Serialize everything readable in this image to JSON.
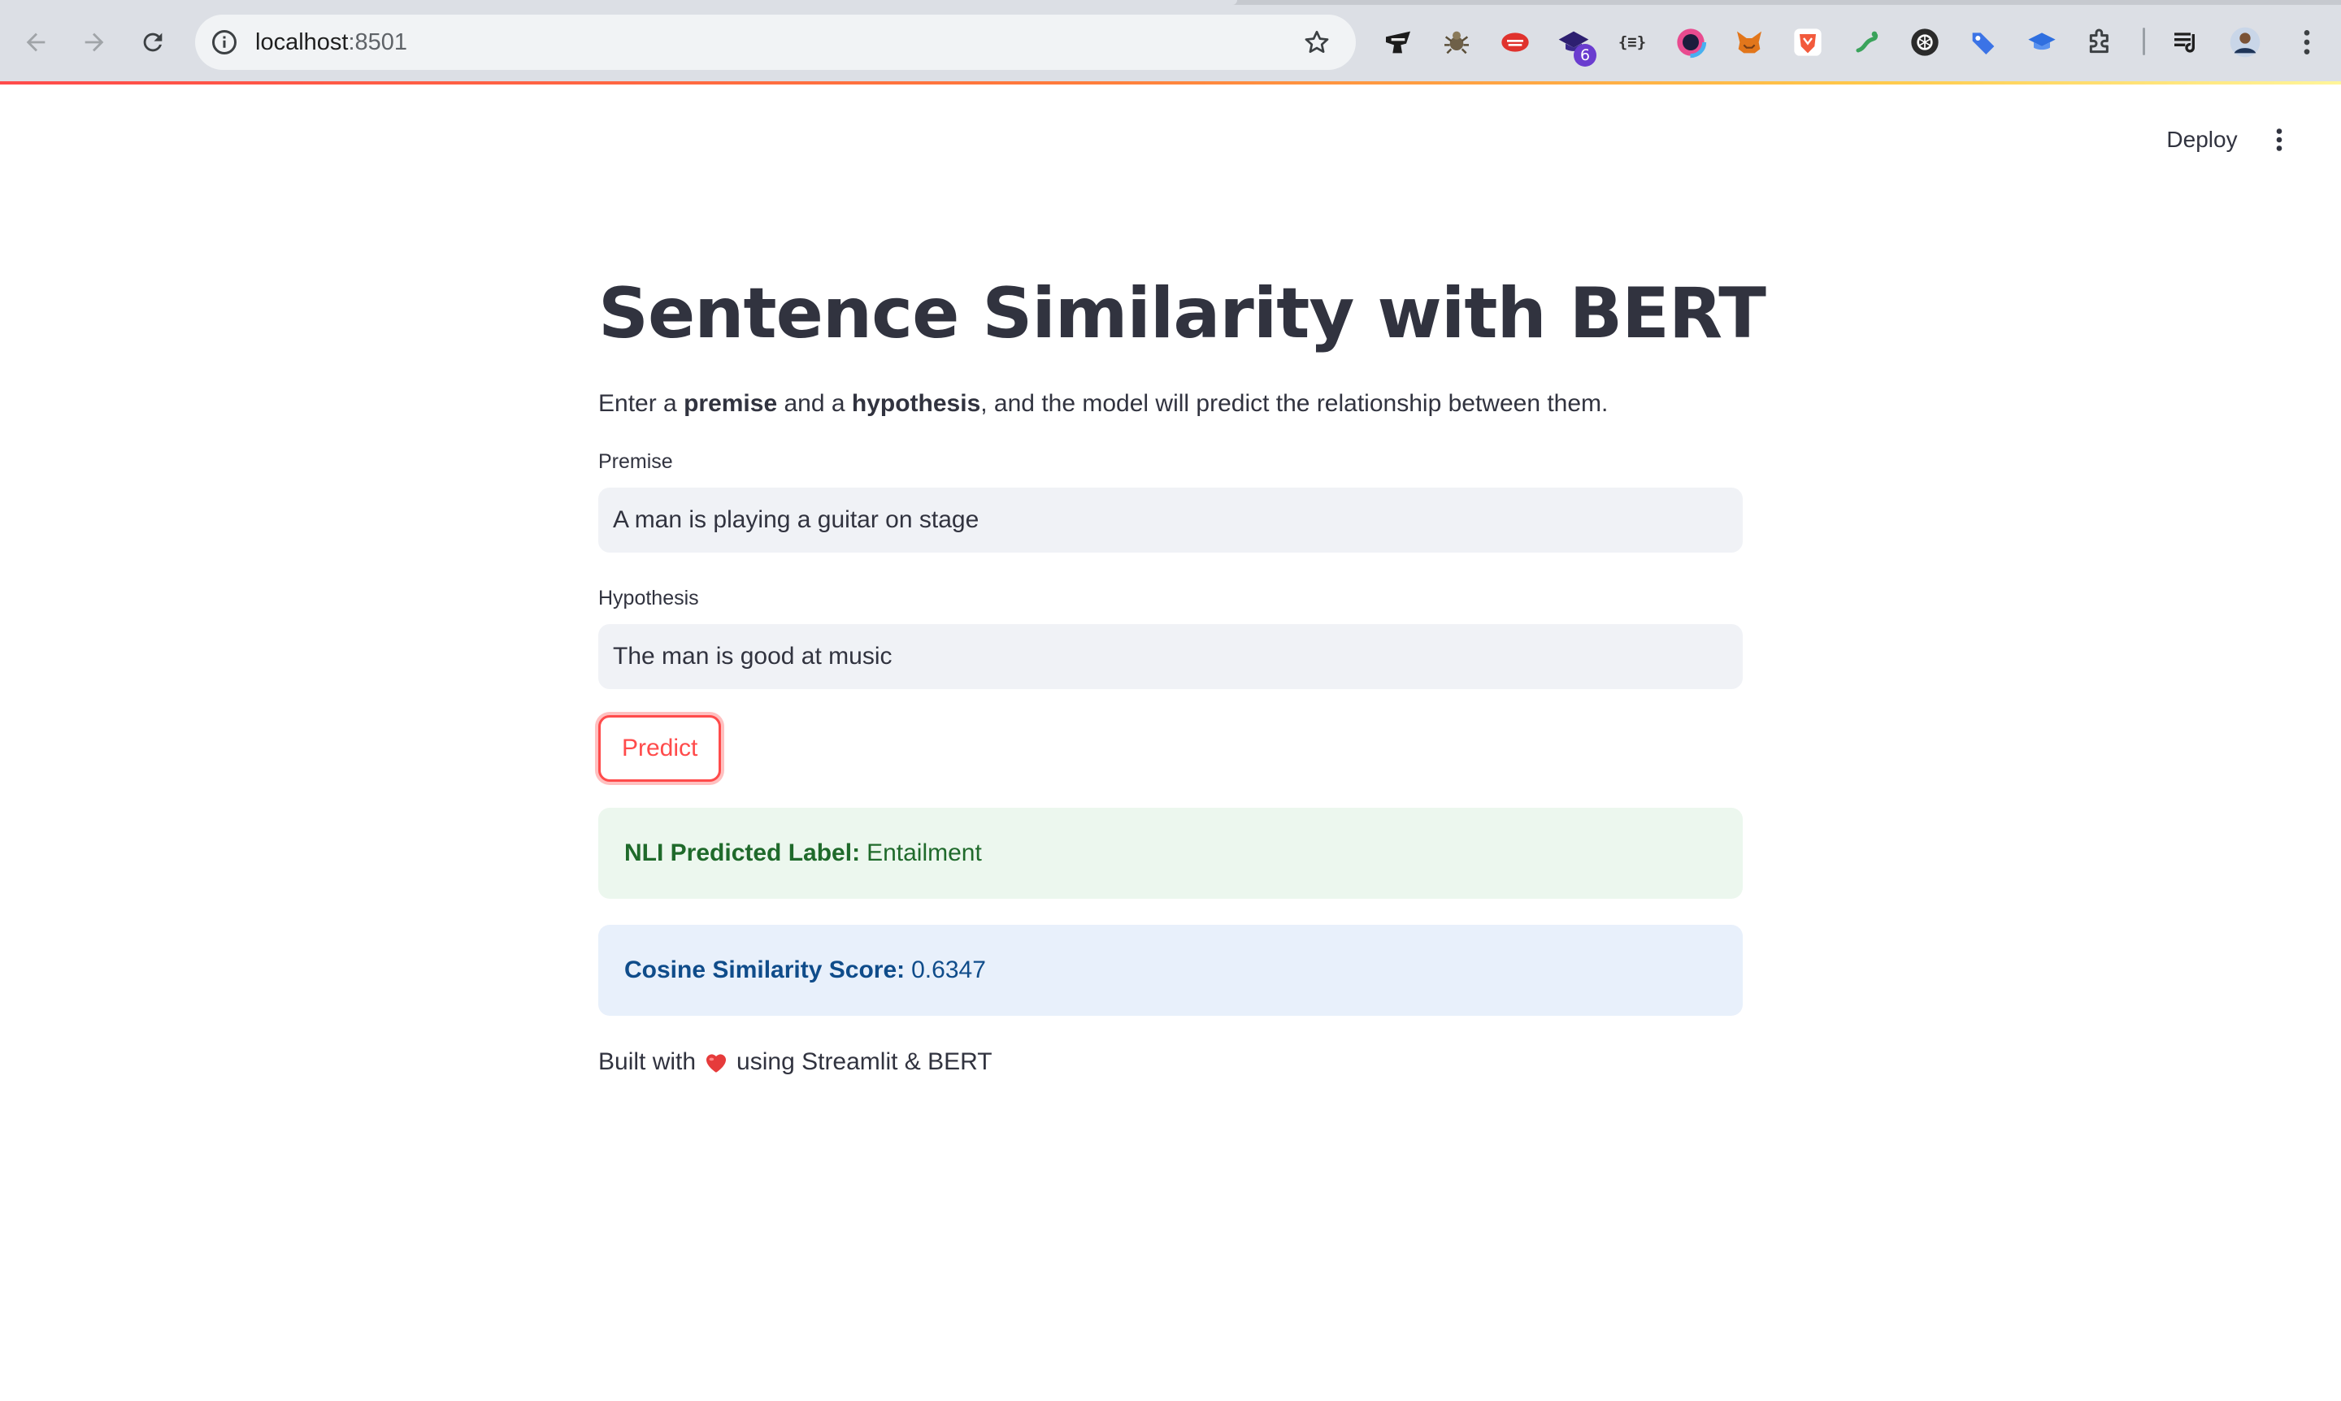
{
  "browser": {
    "url_host": "localhost",
    "url_port": ":8501",
    "extensions": [
      {
        "icon": "ninja-extension-icon"
      },
      {
        "icon": "spider-extension-icon"
      },
      {
        "icon": "red-cloud-extension-icon"
      },
      {
        "icon": "graduation-cap-extension-icon",
        "badge": "6"
      },
      {
        "icon": "json-formatter-extension-icon",
        "glyph": "{≡}"
      },
      {
        "icon": "color-picker-extension-icon"
      },
      {
        "icon": "metamask-fox-extension-icon"
      },
      {
        "icon": "brave-lion-extension-icon"
      },
      {
        "icon": "lizard-extension-icon"
      },
      {
        "icon": "openai-extension-icon"
      },
      {
        "icon": "blue-tag-extension-icon"
      },
      {
        "icon": "blue-cap-extension-icon"
      },
      {
        "icon": "puzzle-extensions-icon"
      }
    ],
    "colors": {
      "chrome_bg": "#dcdfe5",
      "omnibox_bg": "#f1f3f5"
    }
  },
  "app": {
    "header": {
      "deploy_label": "Deploy"
    },
    "title": "Sentence Similarity with BERT",
    "intro": {
      "part1": "Enter a ",
      "bold1": "premise",
      "part2": " and a ",
      "bold2": "hypothesis",
      "part3": ", and the model will predict the relationship between them."
    },
    "premise": {
      "label": "Premise",
      "value": "A man is playing a guitar on stage"
    },
    "hypothesis": {
      "label": "Hypothesis",
      "value": "The man is good at music"
    },
    "predict_label": "Predict",
    "results": {
      "nli_label": "NLI Predicted Label:",
      "nli_value": "Entailment",
      "cosine_label": "Cosine Similarity Score:",
      "cosine_value": "0.6347"
    },
    "footer": {
      "before": "Built with",
      "heart": "❤️",
      "after": "using Streamlit & BERT"
    },
    "colors": {
      "primary": "#ff4b4b",
      "text": "#31333f",
      "success_bg": "#ecf7ee",
      "success_text": "#1f6a2b",
      "info_bg": "#e8f0fb",
      "info_text": "#0f4c8a"
    }
  }
}
